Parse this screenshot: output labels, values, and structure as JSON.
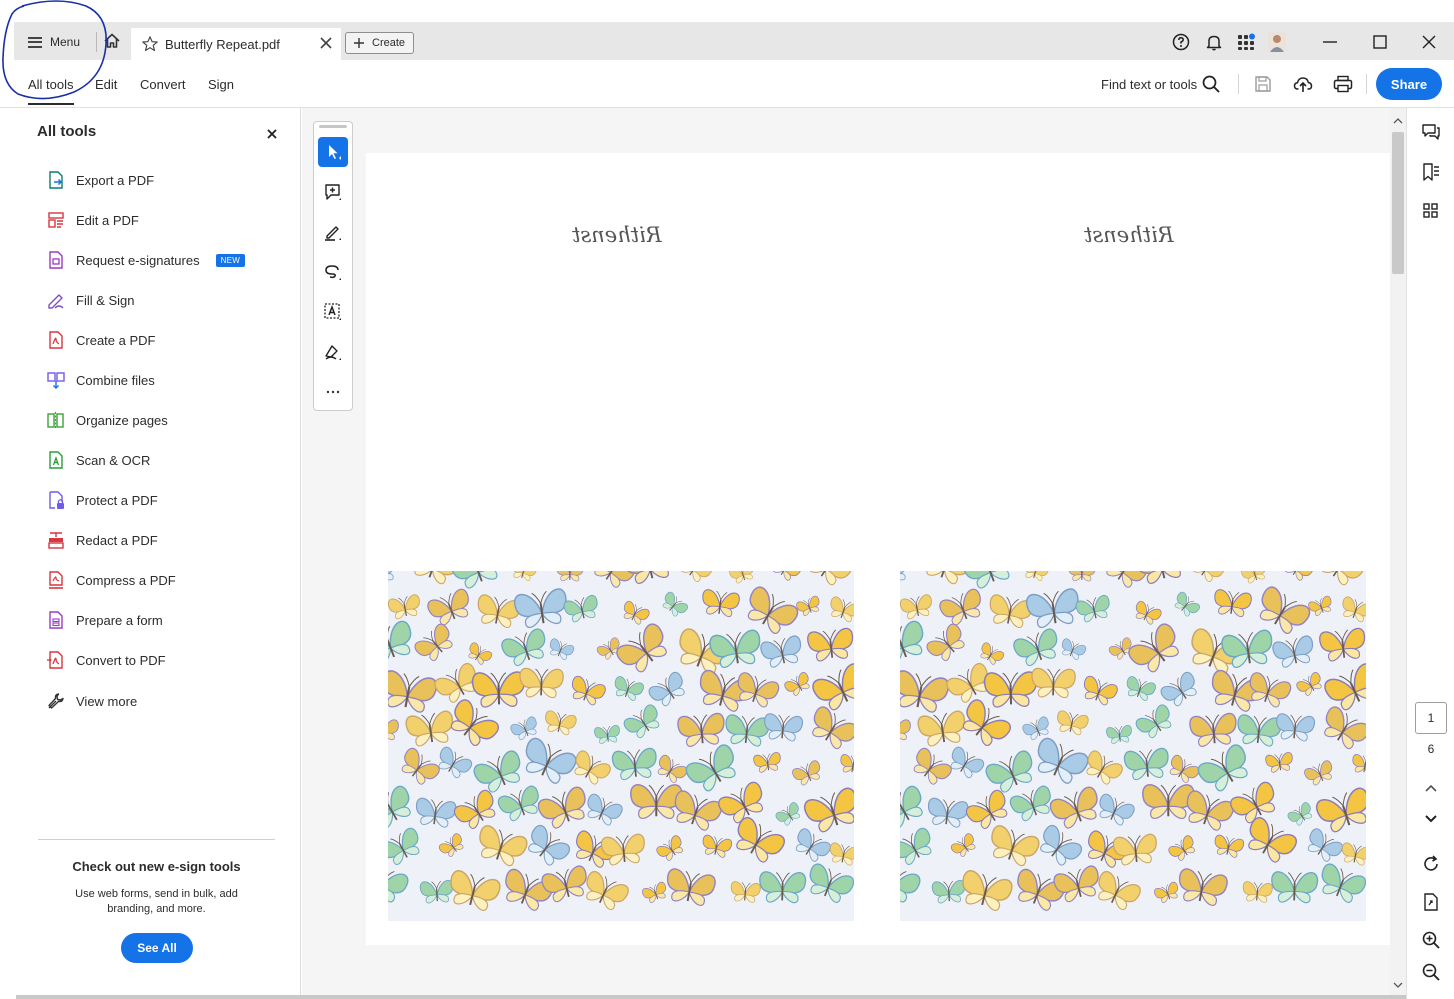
{
  "tabbar": {
    "menu_label": "Menu",
    "doc_tab_title": "Butterfly Repeat.pdf",
    "create_label": "Create"
  },
  "nav": {
    "tabs": [
      "All tools",
      "Edit",
      "Convert",
      "Sign"
    ],
    "active_tab": "All tools",
    "find_placeholder": "Find text or tools",
    "share_label": "Share"
  },
  "sidebar": {
    "title": "All tools",
    "items": [
      {
        "label": "Export a PDF",
        "icon": "export-pdf-icon"
      },
      {
        "label": "Edit a PDF",
        "icon": "edit-pdf-icon"
      },
      {
        "label": "Request e-signatures",
        "icon": "request-esign-icon",
        "badge": "NEW"
      },
      {
        "label": "Fill & Sign",
        "icon": "fill-sign-icon"
      },
      {
        "label": "Create a PDF",
        "icon": "create-pdf-icon"
      },
      {
        "label": "Combine files",
        "icon": "combine-files-icon"
      },
      {
        "label": "Organize pages",
        "icon": "organize-pages-icon"
      },
      {
        "label": "Scan & OCR",
        "icon": "scan-ocr-icon"
      },
      {
        "label": "Protect a PDF",
        "icon": "protect-pdf-icon"
      },
      {
        "label": "Redact a PDF",
        "icon": "redact-pdf-icon"
      },
      {
        "label": "Compress a PDF",
        "icon": "compress-pdf-icon"
      },
      {
        "label": "Prepare a form",
        "icon": "prepare-form-icon"
      },
      {
        "label": "Convert to PDF",
        "icon": "convert-pdf-icon"
      },
      {
        "label": "View more",
        "icon": "wrench-icon"
      }
    ],
    "promo": {
      "title": "Check out new e-sign tools",
      "body": "Use web forms, send in bulk, add branding, and more.",
      "button": "See All"
    }
  },
  "quick_tools": [
    "select-tool",
    "add-comment",
    "draw",
    "freeform-lasso",
    "text-select",
    "sign-fill",
    "more-tools"
  ],
  "document": {
    "signature_text": "Rithenst",
    "pattern_subject": "butterflies"
  },
  "pager": {
    "current_page": "1",
    "total_pages": "6"
  },
  "colors": {
    "accent": "#1473e6",
    "tabbar_bg": "#e7e7e7",
    "canvas_bg": "#f5f5f5",
    "annotation_ink": "#1a2fa8"
  }
}
